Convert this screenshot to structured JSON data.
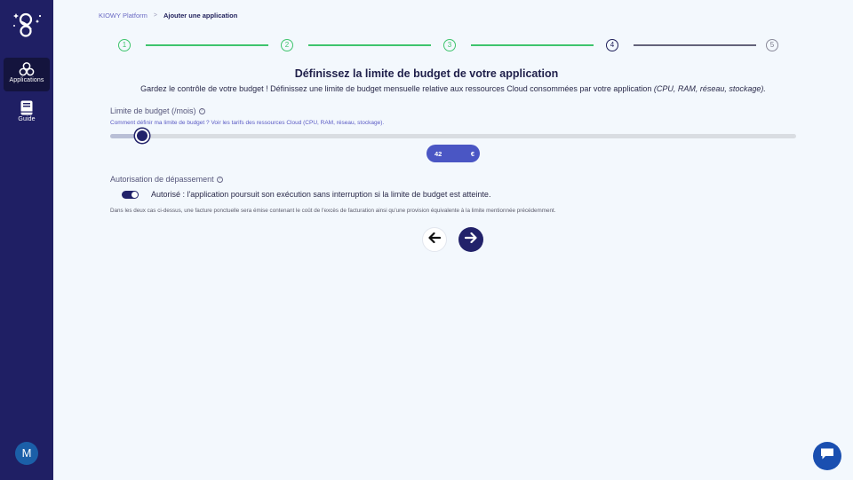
{
  "sidebar": {
    "items": [
      {
        "label": "Applications",
        "icon": "apps-icon",
        "active": true
      },
      {
        "label": "Guide",
        "icon": "book-icon",
        "active": false
      }
    ],
    "avatar_initial": "M"
  },
  "breadcrumb": {
    "root": "KIOWY Platform",
    "separator": ">",
    "current": "Ajouter une application"
  },
  "stepper": {
    "steps": [
      "1",
      "2",
      "3",
      "4",
      "5"
    ],
    "current_step": 4
  },
  "main": {
    "title": "Définissez la limite de budget de votre application",
    "subtitle": "Gardez le contrôle de votre budget ! Définissez une limite de budget mensuelle relative aux ressources Cloud consommées par votre application",
    "subtitle_italic": "(CPU, RAM, réseau, stockage).",
    "budget_label": "Limite de budget (/mois)",
    "help_link_1": "Comment définir ma limite de budget ?",
    "help_link_2": "Voir les tarifs des ressources Cloud (CPU, RAM, réseau, stockage).",
    "budget_value": "42",
    "currency": "€",
    "slider_fraction": 0.047,
    "overrun_label": "Autorisation de dépassement",
    "toggle_on": true,
    "toggle_text": "Autorisé : l'application poursuit son exécution sans interruption si la limite de budget est atteinte.",
    "note": "Dans les deux cas ci-dessus, une facture ponctuelle sera émise contenant le coût de l'excès de facturation ainsi qu'une provision équivalente à la limite mentionnée précédemment."
  },
  "colors": {
    "sidebar_bg": "#1f1f64",
    "accent": "#22226a",
    "step_done": "#3ec46d",
    "budget_box": "#4a56c4",
    "chat": "#1a4fb0"
  }
}
